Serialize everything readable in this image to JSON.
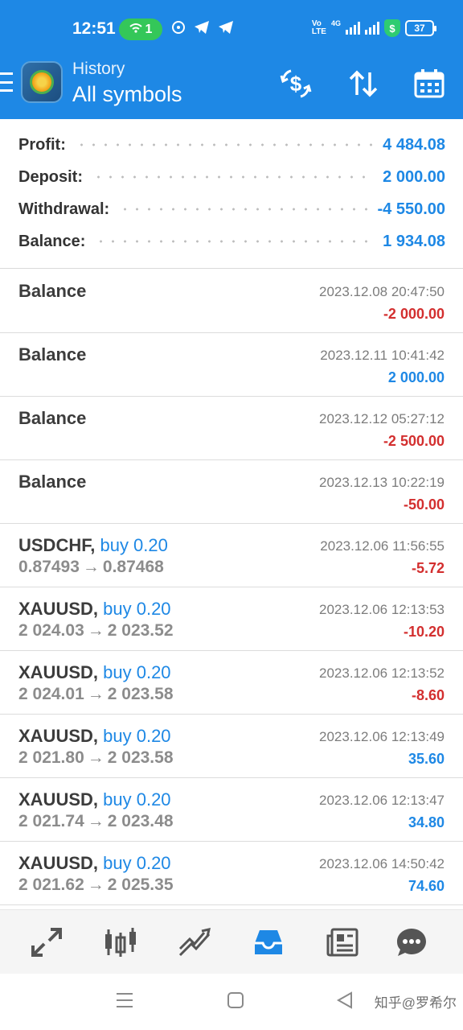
{
  "status_bar": {
    "time": "12:51",
    "hotspot_count": "1",
    "network": "4G",
    "battery": "37"
  },
  "header": {
    "subtitle": "History",
    "title": "All symbols",
    "icons": [
      "menu-icon",
      "app-logo",
      "currency-exchange-icon",
      "sort-icon",
      "calendar-icon"
    ]
  },
  "summary": [
    {
      "label": "Profit:",
      "value": "4 484.08"
    },
    {
      "label": "Deposit:",
      "value": "2 000.00"
    },
    {
      "label": "Withdrawal:",
      "value": "-4 550.00"
    },
    {
      "label": "Balance:",
      "value": "1 934.08"
    }
  ],
  "deals": [
    {
      "title": "Balance",
      "symbol": "",
      "side": "",
      "prices": "",
      "time": "2023.12.08 20:47:50",
      "profit": "-2 000.00",
      "negative": true
    },
    {
      "title": "Balance",
      "symbol": "",
      "side": "",
      "prices": "",
      "time": "2023.12.11 10:41:42",
      "profit": "2 000.00",
      "negative": false
    },
    {
      "title": "Balance",
      "symbol": "",
      "side": "",
      "prices": "",
      "time": "2023.12.12 05:27:12",
      "profit": "-2 500.00",
      "negative": true
    },
    {
      "title": "Balance",
      "symbol": "",
      "side": "",
      "prices": "",
      "time": "2023.12.13 10:22:19",
      "profit": "-50.00",
      "negative": true
    },
    {
      "title": "",
      "symbol": "USDCHF,",
      "side": "buy 0.20",
      "open": "0.87493",
      "close": "0.87468",
      "time": "2023.12.06 11:56:55",
      "profit": "-5.72",
      "negative": true
    },
    {
      "title": "",
      "symbol": "XAUUSD,",
      "side": "buy 0.20",
      "open": "2 024.03",
      "close": "2 023.52",
      "time": "2023.12.06 12:13:53",
      "profit": "-10.20",
      "negative": true
    },
    {
      "title": "",
      "symbol": "XAUUSD,",
      "side": "buy 0.20",
      "open": "2 024.01",
      "close": "2 023.58",
      "time": "2023.12.06 12:13:52",
      "profit": "-8.60",
      "negative": true
    },
    {
      "title": "",
      "symbol": "XAUUSD,",
      "side": "buy 0.20",
      "open": "2 021.80",
      "close": "2 023.58",
      "time": "2023.12.06 12:13:49",
      "profit": "35.60",
      "negative": false
    },
    {
      "title": "",
      "symbol": "XAUUSD,",
      "side": "buy 0.20",
      "open": "2 021.74",
      "close": "2 023.48",
      "time": "2023.12.06 12:13:47",
      "profit": "34.80",
      "negative": false
    },
    {
      "title": "",
      "symbol": "XAUUSD,",
      "side": "buy 0.20",
      "open": "2 021.62",
      "close": "2 025.35",
      "time": "2023.12.06 14:50:42",
      "profit": "74.60",
      "negative": false
    }
  ],
  "bottom_nav": [
    {
      "name": "quotes-icon",
      "active": false
    },
    {
      "name": "chart-icon",
      "active": false
    },
    {
      "name": "trade-icon",
      "active": false
    },
    {
      "name": "history-icon",
      "active": true
    },
    {
      "name": "news-icon",
      "active": false
    },
    {
      "name": "messages-icon",
      "active": false
    }
  ],
  "watermark": "知乎@罗希尔",
  "colors": {
    "accent": "#1e88e5",
    "negative": "#d32f2f",
    "text": "#3c3c3c",
    "muted": "#8c8c8c"
  }
}
